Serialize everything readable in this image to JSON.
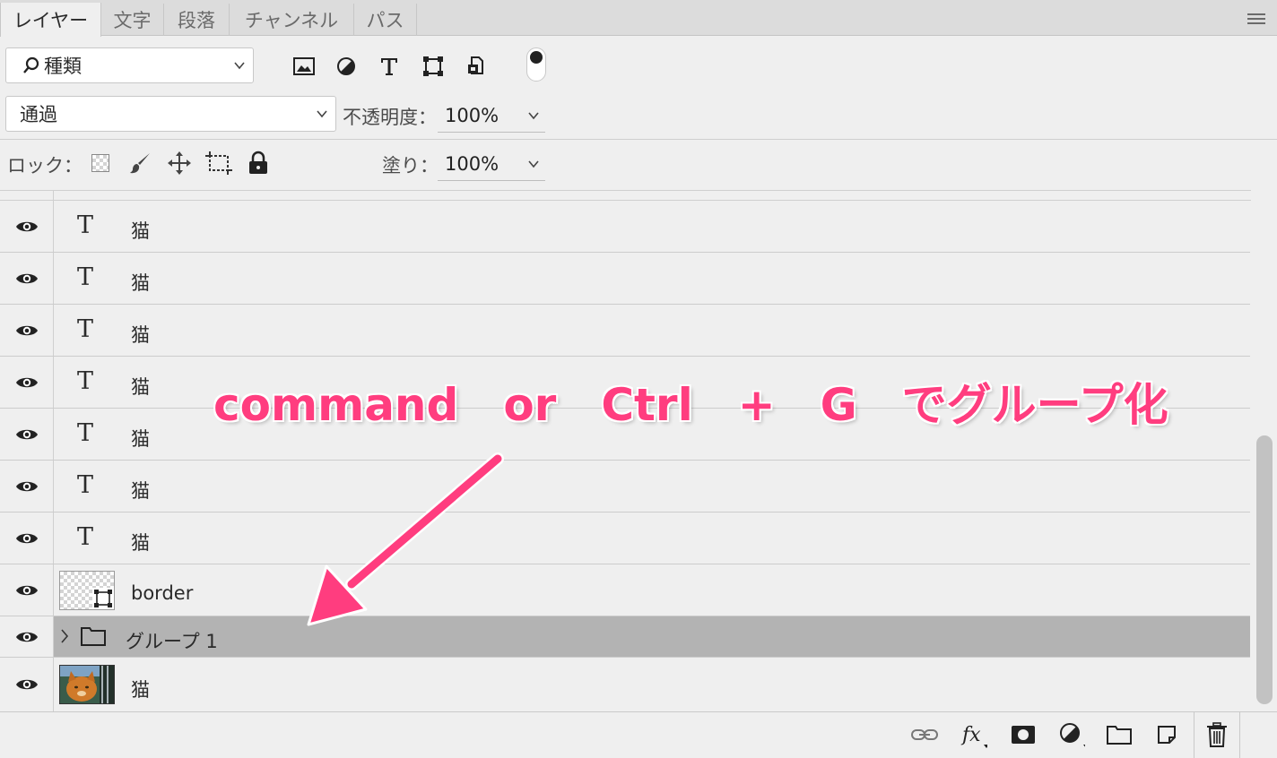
{
  "tabs": [
    {
      "label": "レイヤー",
      "active": true
    },
    {
      "label": "文字",
      "active": false
    },
    {
      "label": "段落",
      "active": false
    },
    {
      "label": "チャンネル",
      "active": false
    },
    {
      "label": "パス",
      "active": false
    }
  ],
  "filter": {
    "kind_label": "種類",
    "icons": [
      "image-filter-icon",
      "adjustment-filter-icon",
      "type-filter-icon",
      "shape-filter-icon",
      "smart-object-filter-icon"
    ]
  },
  "blend": {
    "mode": "通過",
    "opacity_label": "不透明度：",
    "opacity_value": "100%"
  },
  "lock": {
    "label": "ロック：",
    "fill_label": "塗り：",
    "fill_value": "100%"
  },
  "layers": [
    {
      "type": "text",
      "name": "猫",
      "glyph": "T"
    },
    {
      "type": "text",
      "name": "猫",
      "glyph": "T"
    },
    {
      "type": "text",
      "name": "猫",
      "glyph": "T"
    },
    {
      "type": "text",
      "name": "猫",
      "glyph": "T"
    },
    {
      "type": "text",
      "name": "猫",
      "glyph": "T"
    },
    {
      "type": "text",
      "name": "猫",
      "glyph": "T"
    },
    {
      "type": "text",
      "name": "猫",
      "glyph": "T"
    },
    {
      "type": "shape",
      "name": "border"
    },
    {
      "type": "group",
      "name": "グループ 1",
      "selected": true
    },
    {
      "type": "image",
      "name": "猫"
    }
  ],
  "annotation": {
    "text": "command　or　Ctrl　+　G　でグループ化",
    "color": "#ff3d7f"
  },
  "colors": {
    "panel": "#efefef",
    "selected_row": "#b3b3b3",
    "accent": "#ff3d7f"
  }
}
